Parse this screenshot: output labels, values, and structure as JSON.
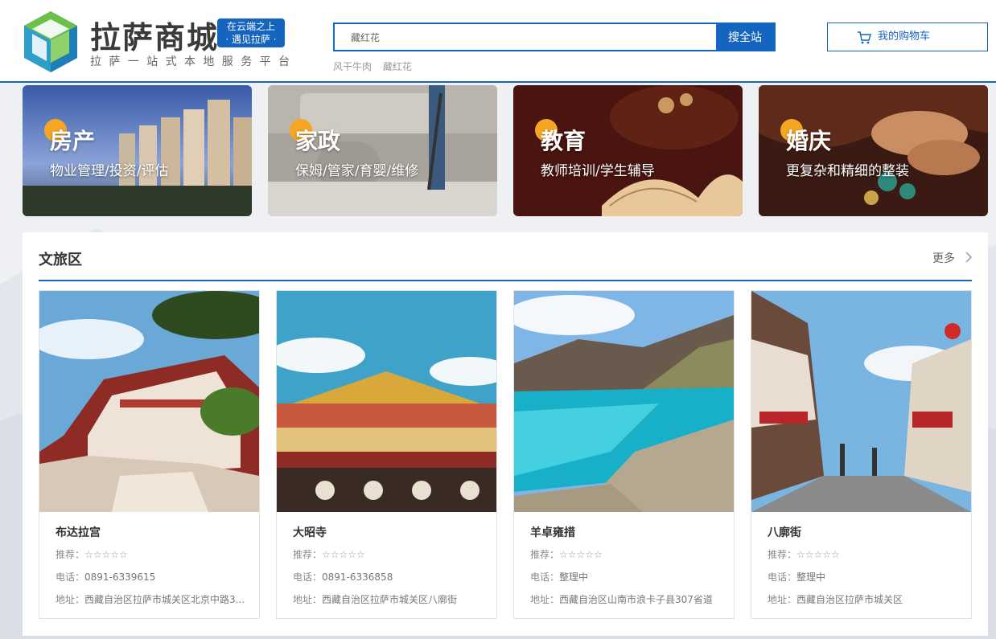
{
  "header": {
    "logo_title": "拉萨商城",
    "logo_badge_line1": "在云端之上",
    "logo_badge_line2": "· 遇见拉萨 ·",
    "logo_slogan": "拉萨一站式本地服务平台",
    "search_value": "藏红花",
    "search_button": "搜全站",
    "hot_words": [
      "风干牛肉",
      "藏红花"
    ],
    "cart_label": "我的购物车",
    "cart_icon": "shopping-cart-icon",
    "accent_color": "#1565c0"
  },
  "banners": [
    {
      "title": "房产",
      "subtitle": "物业管理/投资/评估"
    },
    {
      "title": "家政",
      "subtitle": "保姆/管家/育婴/维修"
    },
    {
      "title": "教育",
      "subtitle": "教师培训/学生辅导"
    },
    {
      "title": "婚庆",
      "subtitle": "更复杂和精细的整装"
    }
  ],
  "tourism": {
    "title": "文旅区",
    "more_label": "更多",
    "more_icon": "chevron-right-icon",
    "cards": [
      {
        "name": "布达拉宫",
        "rec_label": "推荐：",
        "stars": "☆☆☆☆☆",
        "phone_label": "电话：",
        "phone": "0891-6339615",
        "addr_label": "地址：",
        "addr": "西藏自治区拉萨市城关区北京中路3..."
      },
      {
        "name": "大昭寺",
        "rec_label": "推荐：",
        "stars": "☆☆☆☆☆",
        "phone_label": "电话：",
        "phone": "0891-6336858",
        "addr_label": "地址：",
        "addr": "西藏自治区拉萨市城关区八廓街"
      },
      {
        "name": "羊卓雍措",
        "rec_label": "推荐：",
        "stars": "☆☆☆☆☆",
        "phone_label": "电话：",
        "phone": "整理中",
        "addr_label": "地址：",
        "addr": "西藏自治区山南市浪卡子县307省道"
      },
      {
        "name": "八廓街",
        "rec_label": "推荐：",
        "stars": "☆☆☆☆☆",
        "phone_label": "电话：",
        "phone": "整理中",
        "addr_label": "地址：",
        "addr": "西藏自治区拉萨市城关区"
      }
    ]
  }
}
